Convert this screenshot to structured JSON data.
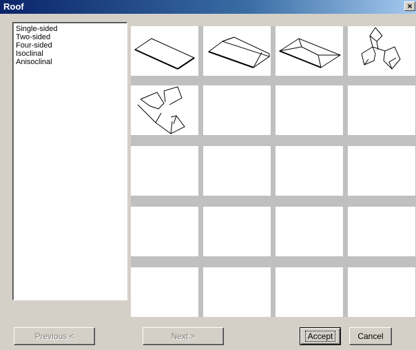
{
  "window": {
    "title": "Roof",
    "close_glyph": "×"
  },
  "list": {
    "items": [
      "Single-sided",
      "Two-sided",
      "Four-sided",
      "Isoclinal",
      "Anisoclinal"
    ]
  },
  "gallery": {
    "thumbnails": [
      "single-sided-roof-icon",
      "two-sided-roof-icon",
      "four-sided-roof-icon",
      "isoclinal-roof-icon",
      "anisoclinal-roof-icon"
    ],
    "empty_cells": 15
  },
  "buttons": {
    "previous": "Previous <",
    "next": "Next >",
    "accept": "Accept",
    "cancel": "Cancel"
  }
}
